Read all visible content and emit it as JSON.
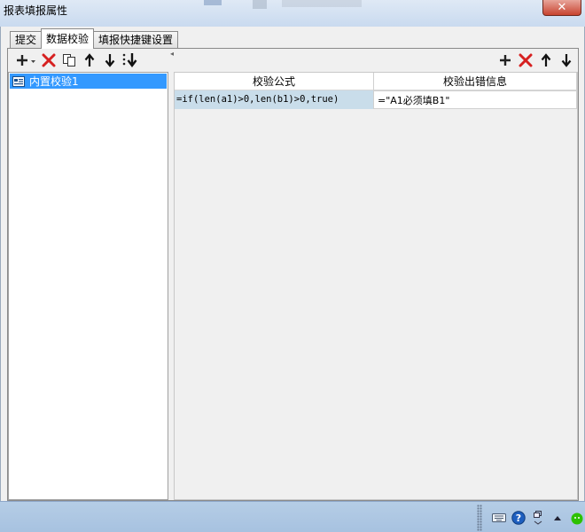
{
  "window": {
    "title": "报表填报属性",
    "close_label": "✕"
  },
  "tabs": [
    {
      "label": "提交"
    },
    {
      "label": "数据校验",
      "active": true
    },
    {
      "label": "填报快捷键设置"
    }
  ],
  "left_toolbar": {
    "buttons": [
      "add-dropdown",
      "delete",
      "copy",
      "move-up",
      "move-down",
      "move-to-bottom"
    ]
  },
  "tree": {
    "items": [
      {
        "label": "内置校验1",
        "selected": true
      }
    ]
  },
  "right_toolbar": {
    "buttons": [
      "add",
      "delete",
      "move-up",
      "move-down"
    ]
  },
  "table": {
    "columns": [
      "校验公式",
      "校验出错信息"
    ],
    "rows": [
      {
        "formula": "=if(len(a1)>0,len(b1)>0,true)",
        "message": "=\"A1必须填B1\""
      }
    ]
  },
  "colors": {
    "selection": "#3399ff",
    "formula_cell": "#c9ddea",
    "delete_red": "#d62020",
    "taskbar": "#b5cde6"
  },
  "taskbar": {
    "tray_icons": [
      "keyboard-icon",
      "help-icon",
      "restore-icon",
      "show-hidden-icons-arrow",
      "wechat-icon"
    ]
  }
}
